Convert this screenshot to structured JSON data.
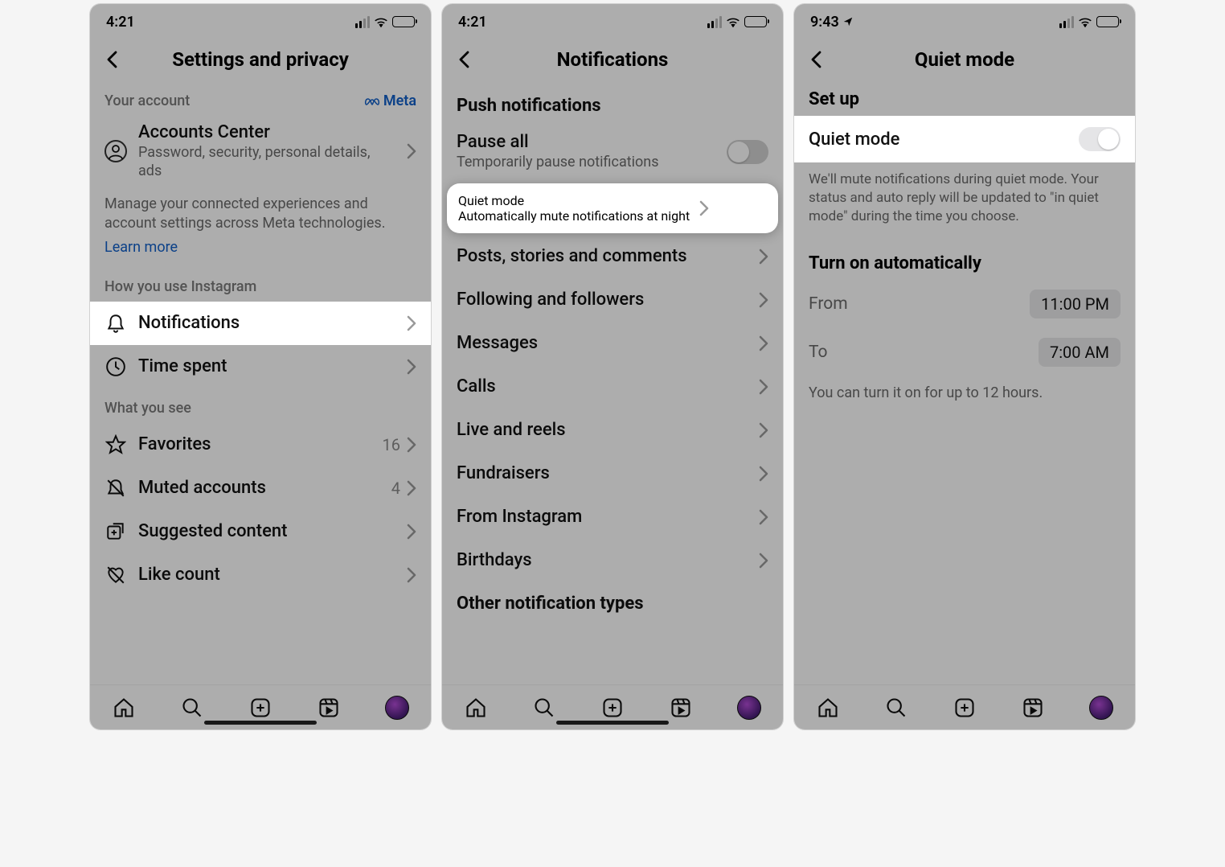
{
  "screens": {
    "settings": {
      "status_time": "4:21",
      "title": "Settings and privacy",
      "your_account_label": "Your account",
      "meta_label": "Meta",
      "accounts_center": {
        "title": "Accounts Center",
        "sub": "Password, security, personal details, ads"
      },
      "manage_desc": "Manage your connected experiences and account settings across Meta technologies.",
      "learn_more": "Learn more",
      "how_use_label": "How you use Instagram",
      "notifications_label": "Notifications",
      "time_spent_label": "Time spent",
      "what_see_label": "What you see",
      "favorites": {
        "label": "Favorites",
        "count": "16"
      },
      "muted": {
        "label": "Muted accounts",
        "count": "4"
      },
      "suggested_label": "Suggested content",
      "like_count_label": "Like count"
    },
    "notifications": {
      "status_time": "4:21",
      "title": "Notifications",
      "push_heading": "Push notifications",
      "pause_all": {
        "title": "Pause all",
        "sub": "Temporarily pause notifications"
      },
      "quiet_mode": {
        "title": "Quiet mode",
        "sub": "Automatically mute notifications at night"
      },
      "items": [
        "Posts, stories and comments",
        "Following and followers",
        "Messages",
        "Calls",
        "Live and reels",
        "Fundraisers",
        "From Instagram",
        "Birthdays"
      ],
      "other_heading": "Other notification types"
    },
    "quiet": {
      "status_time": "9:43",
      "title": "Quiet mode",
      "setup_heading": "Set up",
      "toggle_label": "Quiet mode",
      "desc": "We'll mute notifications during quiet mode. Your status and auto reply will be updated to \"in quiet mode\" during the time you choose.",
      "auto_heading": "Turn on automatically",
      "from_label": "From",
      "from_value": "11:00 PM",
      "to_label": "To",
      "to_value": "7:00 AM",
      "note": "You can turn it on for up to 12 hours."
    }
  }
}
